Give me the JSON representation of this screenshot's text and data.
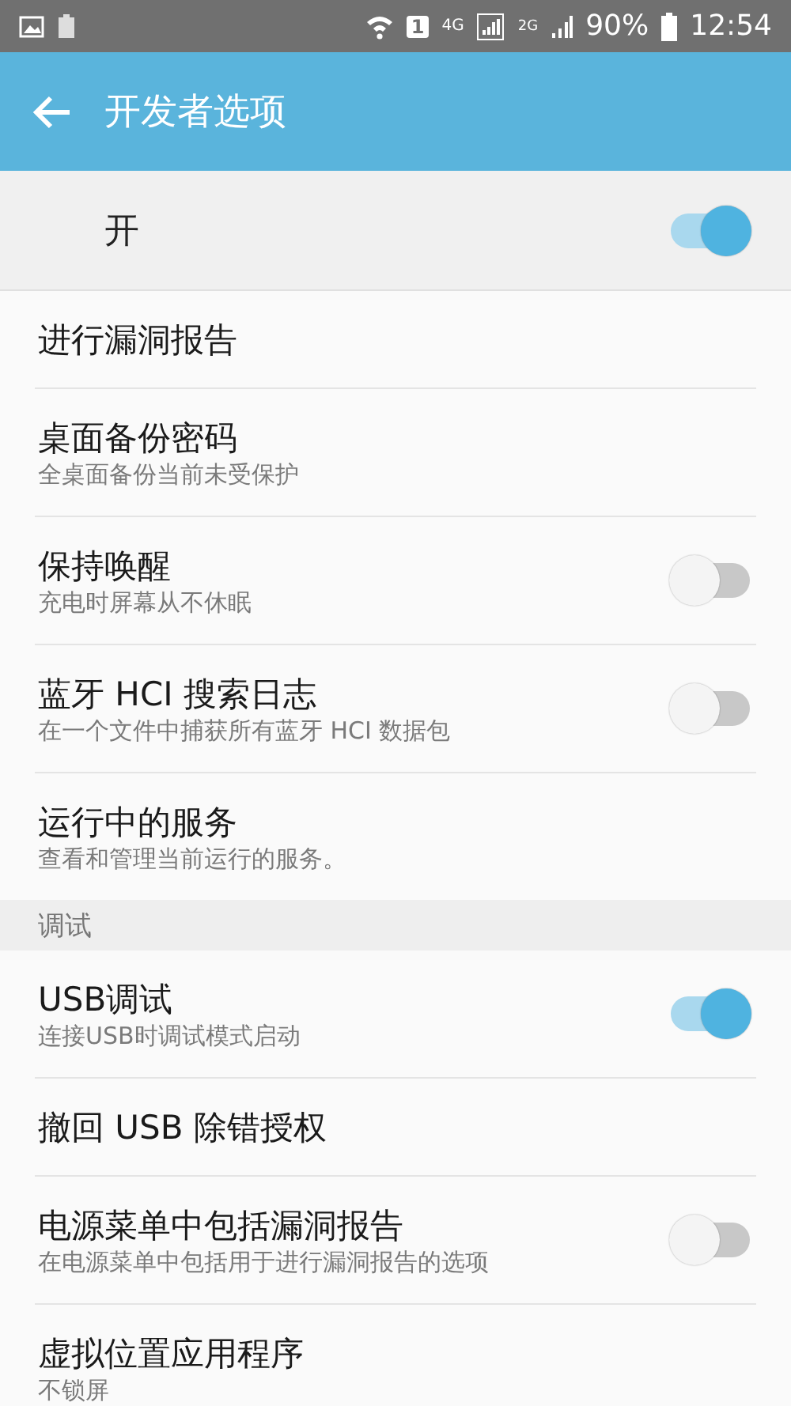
{
  "status_bar": {
    "network": "4G",
    "network2": "2G",
    "sim": "1",
    "battery": "90%",
    "time": "12:54"
  },
  "app_bar": {
    "title": "开发者选项"
  },
  "master_switch": {
    "label": "开",
    "on": true
  },
  "sections": [
    {
      "items": [
        {
          "kind": "plain",
          "title": "进行漏洞报告"
        },
        {
          "kind": "plain",
          "title": "桌面备份密码",
          "subtitle": "全桌面备份当前未受保护"
        },
        {
          "kind": "toggle",
          "title": "保持唤醒",
          "subtitle": "充电时屏幕从不休眠",
          "on": false
        },
        {
          "kind": "toggle",
          "title": "蓝牙 HCI 搜索日志",
          "subtitle": "在一个文件中捕获所有蓝牙 HCI 数据包",
          "on": false
        },
        {
          "kind": "plain",
          "title": "运行中的服务",
          "subtitle": "查看和管理当前运行的服务。"
        }
      ]
    },
    {
      "header": "调试",
      "items": [
        {
          "kind": "toggle",
          "title": "USB调试",
          "subtitle": "连接USB时调试模式启动",
          "on": true
        },
        {
          "kind": "plain",
          "title": "撤回 USB 除错授权"
        },
        {
          "kind": "toggle",
          "title": "电源菜单中包括漏洞报告",
          "subtitle": "在电源菜单中包括用于进行漏洞报告的选项",
          "on": false
        },
        {
          "kind": "plain",
          "title": "虚拟位置应用程序",
          "subtitle": "不锁屏"
        }
      ]
    }
  ]
}
